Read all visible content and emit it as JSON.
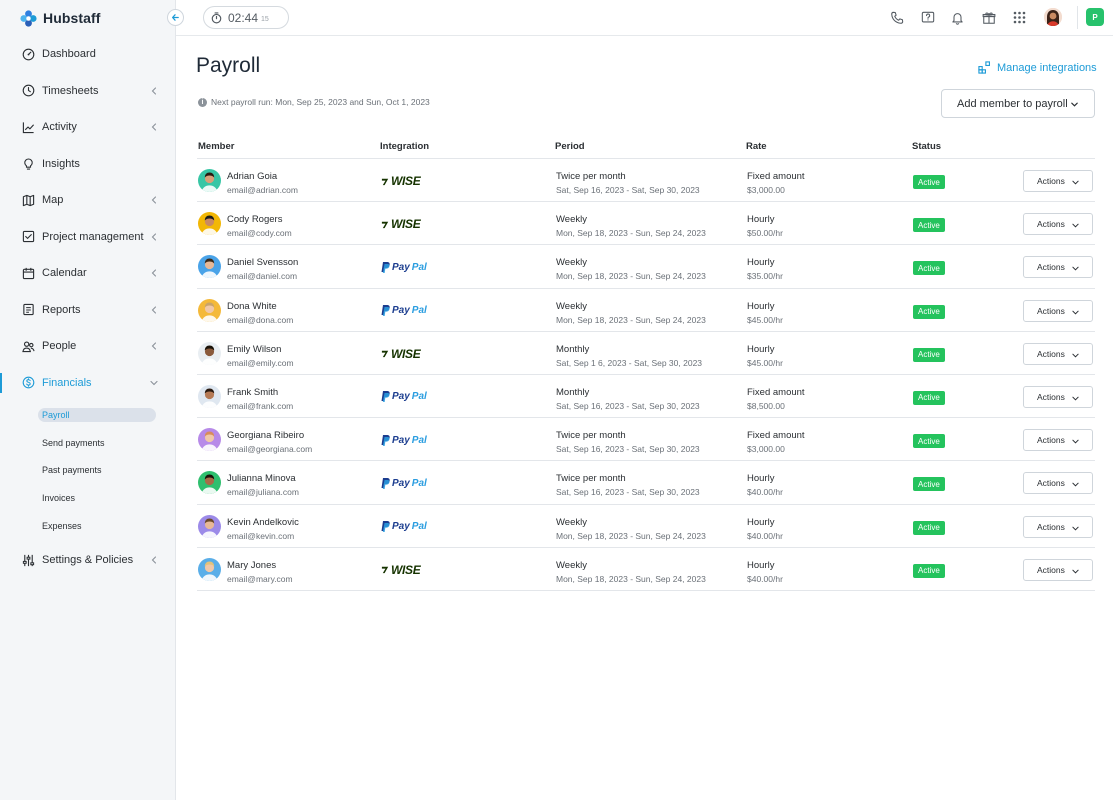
{
  "app": {
    "brand": "Hubstaff"
  },
  "colors": {
    "accent": "#1d9bd7",
    "active_badge": "#24c35d",
    "org_badge": "#27c26c"
  },
  "sidebar": {
    "items": [
      {
        "label": "Dashboard",
        "icon": "dashboard-icon",
        "chevron": false
      },
      {
        "label": "Timesheets",
        "icon": "clock-icon",
        "chevron": true
      },
      {
        "label": "Activity",
        "icon": "activity-chart-icon",
        "chevron": true
      },
      {
        "label": "Insights",
        "icon": "lightbulb-icon",
        "chevron": false
      },
      {
        "label": "Map",
        "icon": "map-icon",
        "chevron": true
      },
      {
        "label": "Project management",
        "icon": "checkbox-icon",
        "chevron": true
      },
      {
        "label": "Calendar",
        "icon": "calendar-icon",
        "chevron": true
      },
      {
        "label": "Reports",
        "icon": "report-icon",
        "chevron": true
      },
      {
        "label": "People",
        "icon": "people-icon",
        "chevron": true
      },
      {
        "label": "Financials",
        "icon": "dollar-icon",
        "chevron": true,
        "active": true
      }
    ],
    "sub_items": [
      "Payroll",
      "Send payments",
      "Past payments",
      "Invoices",
      "Expenses"
    ],
    "settings": {
      "label": "Settings & Policies",
      "icon": "sliders-icon"
    }
  },
  "topbar": {
    "timer": {
      "time": "02:44",
      "seconds": "15"
    },
    "icons": [
      "phone-icon",
      "help-icon",
      "bell-icon",
      "gift-icon",
      "apps-grid-icon"
    ],
    "org_initial": "P"
  },
  "main": {
    "title": "Payroll",
    "manage_integrations": "Manage integrations",
    "next_run": "Next payroll run: Mon, Sep 25, 2023 and Sun, Oct 1, 2023",
    "add_member": "Add member to payroll",
    "columns": [
      "Member",
      "Integration",
      "Period",
      "Rate",
      "Status"
    ],
    "action_label": "Actions",
    "rows": [
      {
        "name": "Adrian Goia",
        "email": "email@adrian.com",
        "integration": "wise",
        "period": "Twice per month",
        "range": "Sat, Sep 16, 2023 - Sat, Sep 30, 2023",
        "rate_type": "Fixed amount",
        "rate": "$3,000.00",
        "status": "Active",
        "av_bg": "#38c6a5",
        "skin": "#d9a07a"
      },
      {
        "name": "Cody Rogers",
        "email": "email@cody.com",
        "integration": "wise",
        "period": "Weekly",
        "range": "Mon, Sep 18, 2023 - Sun, Sep 24, 2023",
        "rate_type": "Hourly",
        "rate": "$50.00/hr",
        "status": "Active",
        "av_bg": "#f2b705",
        "skin": "#c98a62"
      },
      {
        "name": "Daniel Svensson",
        "email": "email@daniel.com",
        "integration": "paypal",
        "period": "Weekly",
        "range": "Mon, Sep 18, 2023 - Sun, Sep 24, 2023",
        "rate_type": "Hourly",
        "rate": "$35.00/hr",
        "status": "Active",
        "av_bg": "#4aa3e8",
        "skin": "#e8b896"
      },
      {
        "name": "Dona White",
        "email": "email@dona.com",
        "integration": "paypal",
        "period": "Weekly",
        "range": "Mon, Sep 18, 2023 - Sun, Sep 24, 2023",
        "rate_type": "Hourly",
        "rate": "$45.00/hr",
        "status": "Active",
        "av_bg": "#f4b93a",
        "skin": "#f0c8a8"
      },
      {
        "name": "Emily Wilson",
        "email": "email@emily.com",
        "integration": "wise",
        "period": "Monthly",
        "range": "Sat, Sep 1  6, 2023 - Sat, Sep 30, 2023",
        "rate_type": "Hourly",
        "rate": "$45.00/hr",
        "status": "Active",
        "av_bg": "#e9eef2",
        "skin": "#8a5a3c"
      },
      {
        "name": "Frank Smith",
        "email": "email@frank.com",
        "integration": "paypal",
        "period": "Monthly",
        "range": "Sat, Sep 16, 2023 - Sat, Sep 30, 2023",
        "rate_type": "Fixed amount",
        "rate": "$8,500.00",
        "status": "Active",
        "av_bg": "#dfe7f0",
        "skin": "#b67a55"
      },
      {
        "name": "Georgiana Ribeiro",
        "email": "email@georgiana.com",
        "integration": "paypal",
        "period": "Twice per month",
        "range": "Sat, Sep 16, 2023 - Sat, Sep 30, 2023",
        "rate_type": "Fixed amount",
        "rate": "$3,000.00",
        "status": "Active",
        "av_bg": "#b78ae8",
        "skin": "#f0c8a8"
      },
      {
        "name": "Julianna Minova",
        "email": "email@juliana.com",
        "integration": "paypal",
        "period": "Twice per month",
        "range": "Sat, Sep 16, 2023 - Sat, Sep 30, 2023",
        "rate_type": "Hourly",
        "rate": "$40.00/hr",
        "status": "Active",
        "av_bg": "#2fbf6e",
        "skin": "#a86b48"
      },
      {
        "name": "Kevin Andelkovic",
        "email": "email@kevin.com",
        "integration": "paypal",
        "period": "Weekly",
        "range": "Mon, Sep 18, 2023 - Sun, Sep 24, 2023",
        "rate_type": "Hourly",
        "rate": "$40.00/hr",
        "status": "Active",
        "av_bg": "#9c8ae8",
        "skin": "#e8b896"
      },
      {
        "name": "Mary Jones",
        "email": "email@mary.com",
        "integration": "wise",
        "period": "Weekly",
        "range": "Mon, Sep 18, 2023 - Sun, Sep 24, 2023",
        "rate_type": "Hourly",
        "rate": "$40.00/hr",
        "status": "Active",
        "av_bg": "#5aaee8",
        "skin": "#f0c8a8"
      }
    ]
  }
}
